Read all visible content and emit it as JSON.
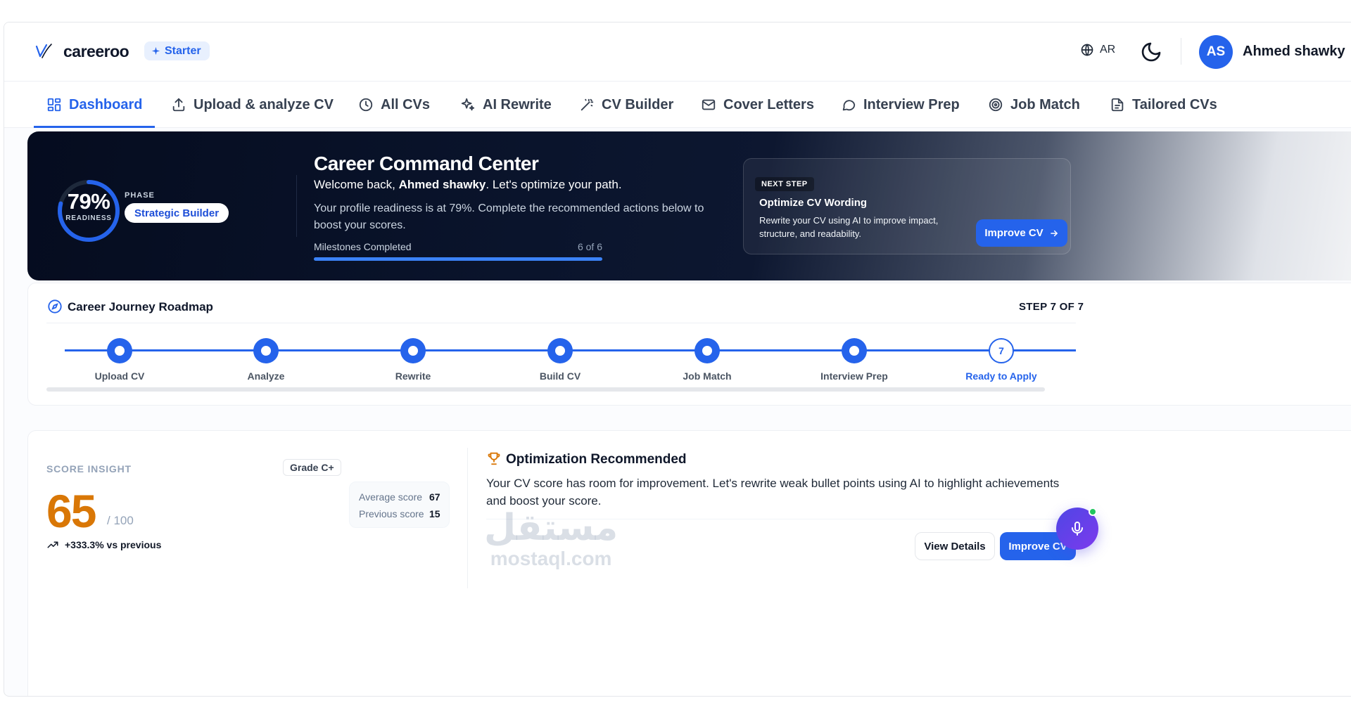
{
  "header": {
    "brand": "careeroo",
    "plan_badge": "Starter",
    "language": "AR",
    "avatar_initials": "AS",
    "user_name": "Ahmed shawky"
  },
  "nav": {
    "items": [
      {
        "label": "Dashboard",
        "icon": "grid-icon",
        "active": true
      },
      {
        "label": "Upload & analyze CV",
        "icon": "upload-icon"
      },
      {
        "label": "All CVs",
        "icon": "clock-icon"
      },
      {
        "label": "AI Rewrite",
        "icon": "sparkles-icon"
      },
      {
        "label": "CV Builder",
        "icon": "magic-wand-icon"
      },
      {
        "label": "Cover Letters",
        "icon": "mail-icon"
      },
      {
        "label": "Interview Prep",
        "icon": "chat-icon"
      },
      {
        "label": "Job Match",
        "icon": "target-icon"
      },
      {
        "label": "Tailored CVs",
        "icon": "document-icon"
      }
    ]
  },
  "hero": {
    "readiness_value": "79%",
    "readiness_fraction": 0.79,
    "readiness_label": "READINESS",
    "phase_label": "PHASE",
    "phase_value": "Strategic Builder",
    "title": "Career Command Center",
    "welcome_prefix": "Welcome back, ",
    "welcome_name": "Ahmed shawky",
    "welcome_suffix": ". Let's optimize your path.",
    "description": "Your profile readiness is at 79%. Complete the recommended actions below to boost your scores.",
    "milestones_label": "Milestones Completed",
    "milestones_value": "6 of 6",
    "milestones_fraction": 1.0,
    "next_step": {
      "tag": "NEXT STEP",
      "title": "Optimize CV Wording",
      "description": "Rewrite your CV using AI to improve impact, structure, and readability.",
      "button": "Improve CV"
    }
  },
  "roadmap": {
    "title": "Career Journey Roadmap",
    "step_indicator": "STEP 7 OF 7",
    "steps": [
      {
        "label": "Upload CV",
        "done": true
      },
      {
        "label": "Analyze",
        "done": true
      },
      {
        "label": "Rewrite",
        "done": true
      },
      {
        "label": "Build CV",
        "done": true
      },
      {
        "label": "Job Match",
        "done": true
      },
      {
        "label": "Interview Prep",
        "done": true
      },
      {
        "label": "Ready to Apply",
        "done": false,
        "number": "7"
      }
    ]
  },
  "score": {
    "label": "SCORE INSIGHT",
    "grade": "Grade C+",
    "value": "65",
    "max": "/ 100",
    "average_label": "Average score",
    "average_value": "67",
    "previous_label": "Previous score",
    "previous_value": "15",
    "trend": "+333.3% vs previous"
  },
  "optimization": {
    "title": "Optimization Recommended",
    "text": "Your CV score has room for improvement. Let's rewrite weak bullet points using AI to highlight achievements and boost your score.",
    "view_button": "View Details",
    "improve_button": "Improve CV"
  },
  "watermark": {
    "arabic": "مستقل",
    "latin": "mostaql.com"
  },
  "colors": {
    "accent": "#2563eb",
    "score": "#d97706"
  }
}
